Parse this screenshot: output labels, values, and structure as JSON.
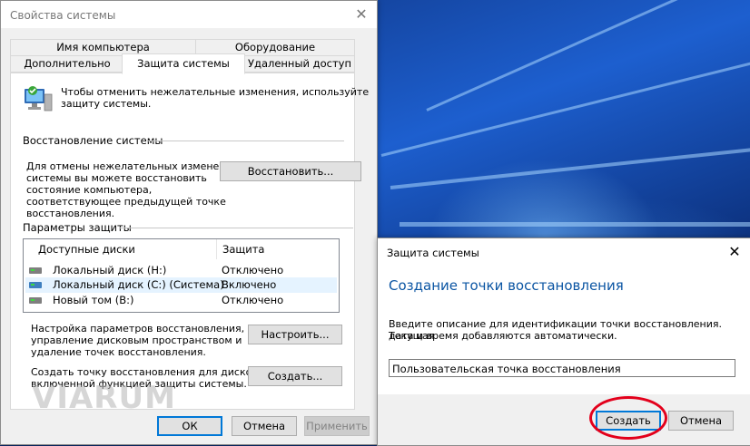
{
  "main_dialog": {
    "title": "Свойства системы",
    "close_glyph": "✕",
    "tabs_row1": [
      "Имя компьютера",
      "Оборудование"
    ],
    "tabs_row2": [
      "Дополнительно",
      "Защита системы",
      "Удаленный доступ"
    ],
    "intro_text_line1": "Чтобы отменить нежелательные изменения, используйте",
    "intro_text_line2": "защиту системы.",
    "restore_section_label": "Восстановление системы",
    "restore_text": [
      "Для отмены нежелательных изменений",
      "системы вы можете восстановить",
      "состояние компьютера,",
      "соответствующее предыдущей точке",
      "восстановления."
    ],
    "restore_button": "Восстановить...",
    "params_section_label": "Параметры защиты",
    "list_headers": {
      "drives": "Доступные диски",
      "protection": "Защита"
    },
    "drives": [
      {
        "name": "Локальный диск (H:)",
        "status": "Отключено"
      },
      {
        "name": "Локальный диск (C:) (Система)",
        "status": "Включено"
      },
      {
        "name": "Новый том (B:)",
        "status": "Отключено"
      }
    ],
    "configure_text": [
      "Настройка параметров восстановления,",
      "управление дисковым пространством и",
      "удаление точек восстановления."
    ],
    "configure_button": "Настроить...",
    "create_text": [
      "Создать точку восстановления для дисков с",
      "включенной функцией защиты системы."
    ],
    "create_button": "Создать...",
    "ok_button": "ОК",
    "cancel_button": "Отмена",
    "apply_button": "Применить"
  },
  "watermark": "VIARUM",
  "restore_dialog": {
    "title": "Защита системы",
    "close_glyph": "✕",
    "heading": "Создание точки восстановления",
    "description_line1": "Введите описание для идентификации точки восстановления. Текущая",
    "description_line2": "дата и время добавляются автоматически.",
    "input_value": "Пользовательская точка восстановления",
    "create_button": "Создать",
    "cancel_button": "Отмена"
  },
  "colors": {
    "accent": "#0078d7",
    "heading_blue": "#0b55a3",
    "highlight_circle": "#e3001b"
  }
}
